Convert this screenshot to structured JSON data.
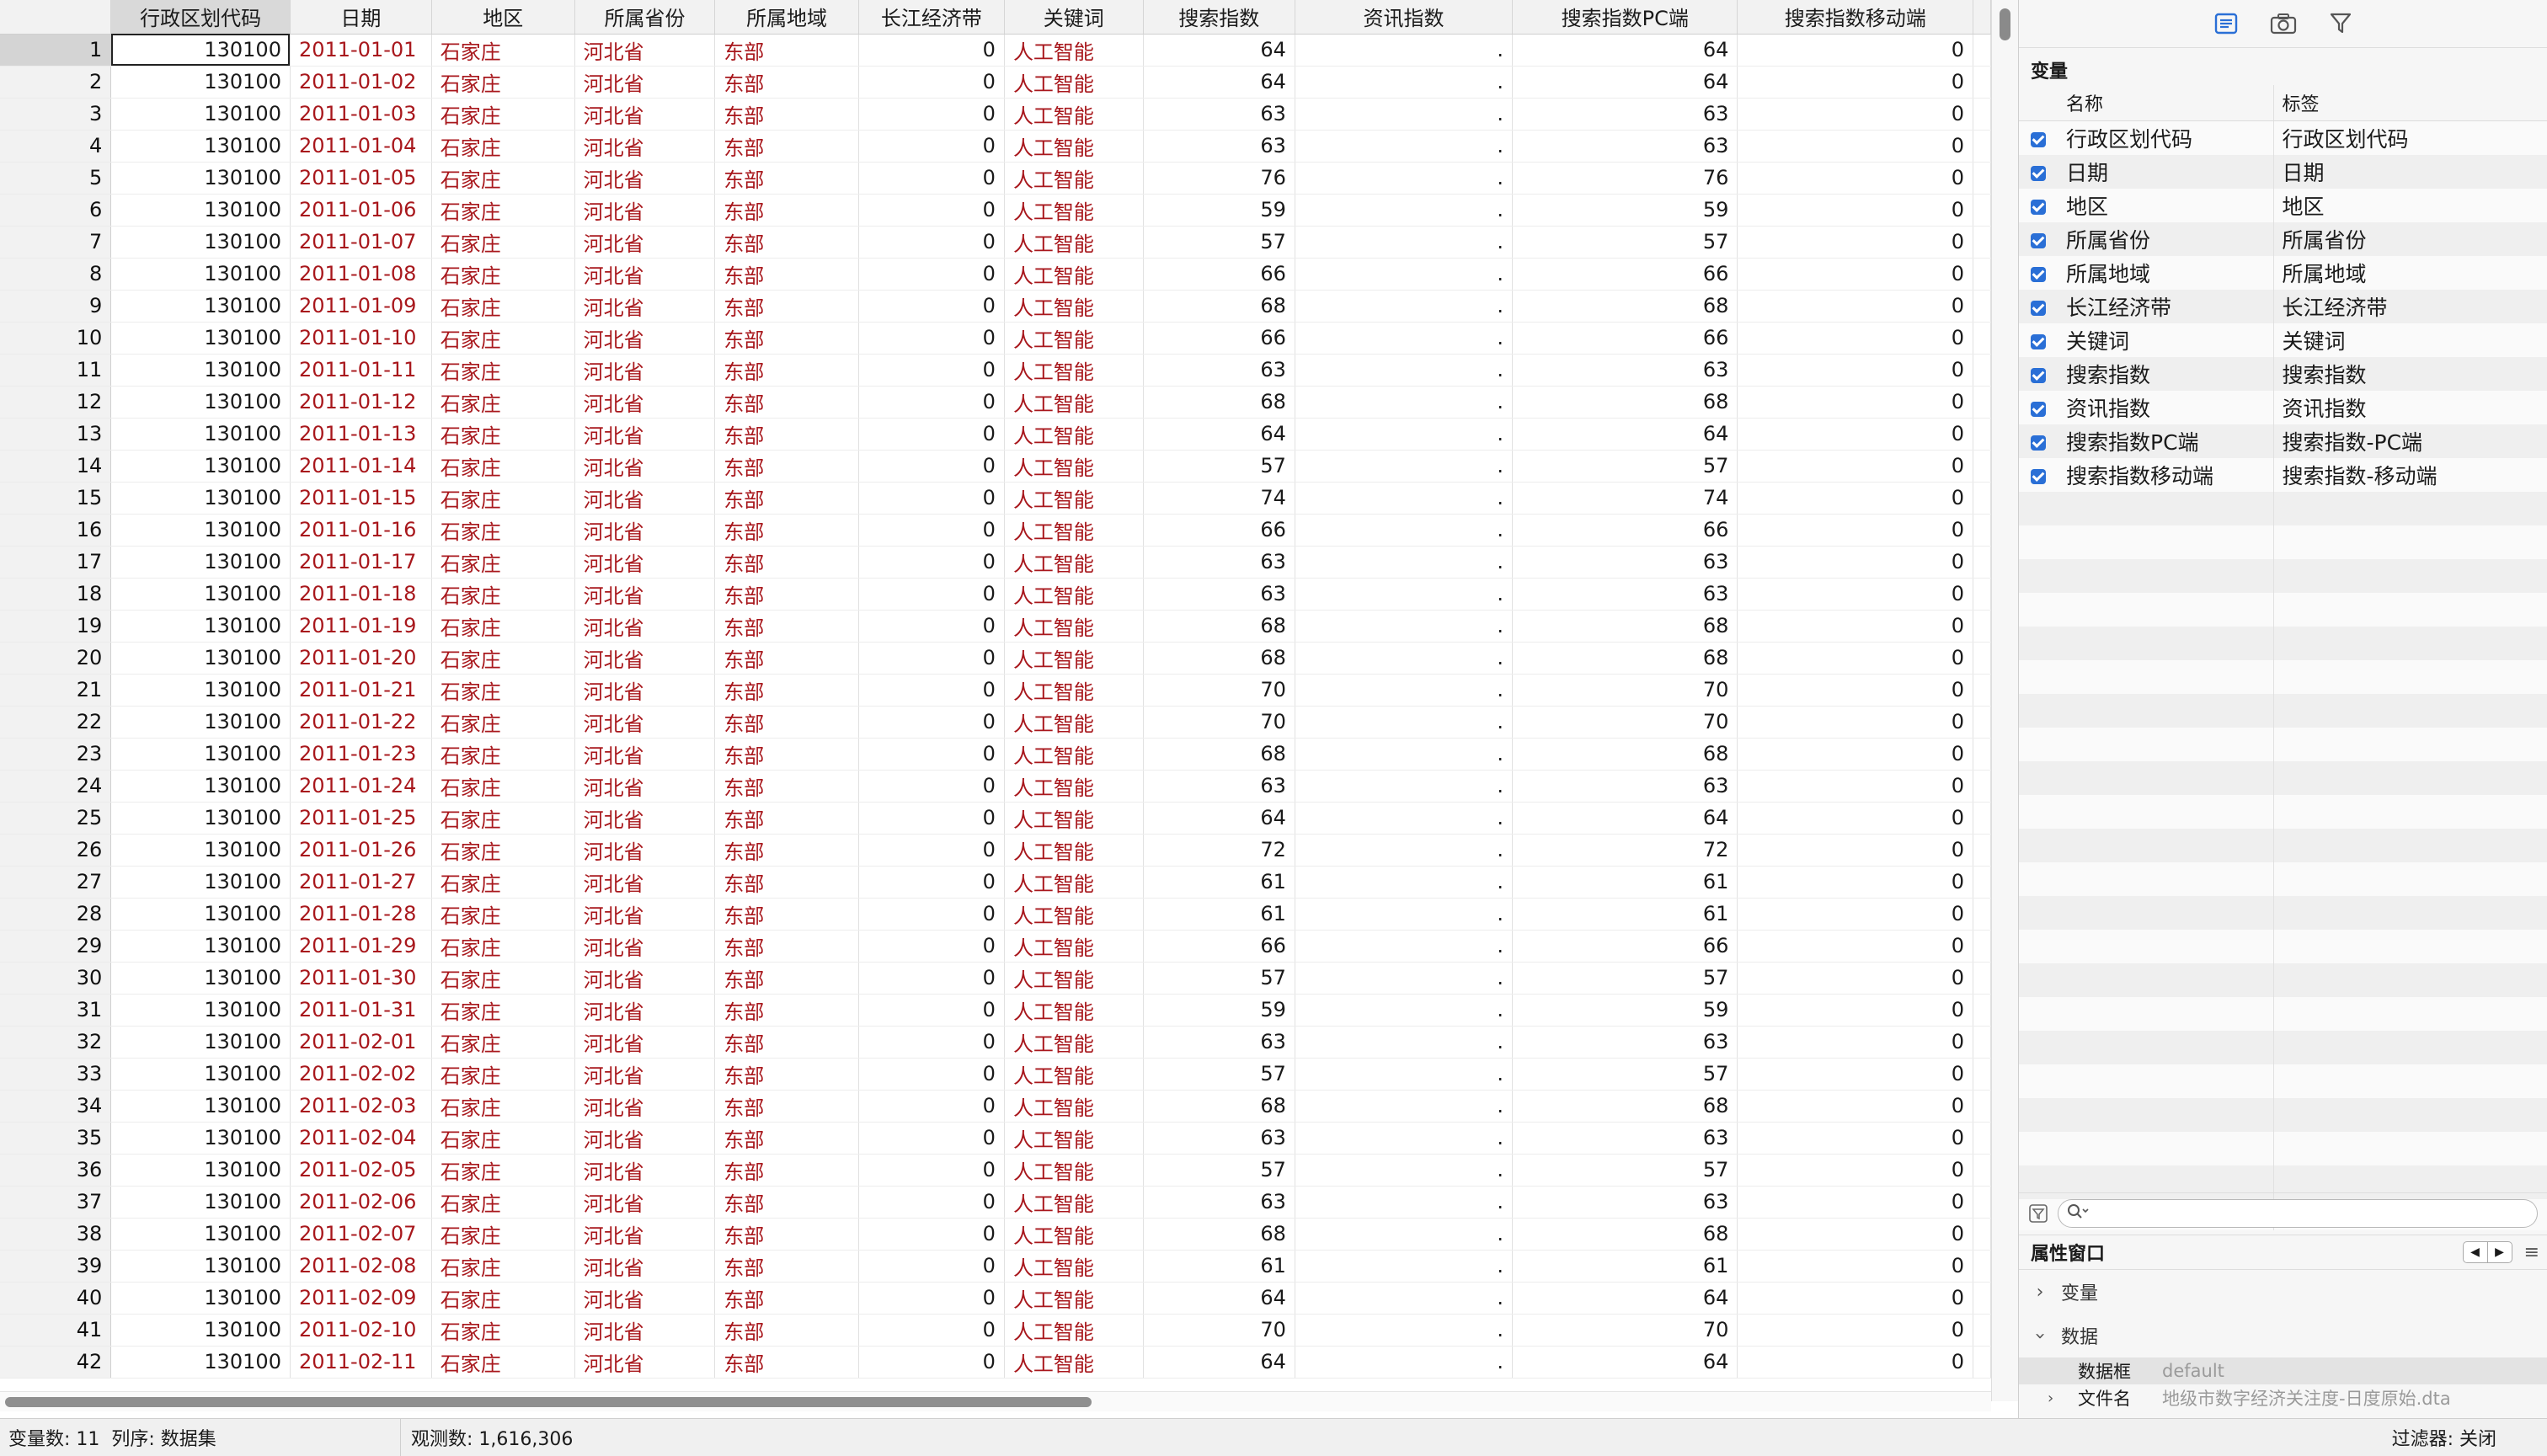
{
  "columns": [
    "行政区划代码",
    "日期",
    "地区",
    "所属省份",
    "所属地域",
    "长江经济带",
    "关键词",
    "搜索指数",
    "资讯指数",
    "搜索指数PC端",
    "搜索指数移动端"
  ],
  "column_types": [
    "num",
    "str",
    "str",
    "str",
    "str",
    "num",
    "str",
    "num",
    "dot",
    "num",
    "num"
  ],
  "sorted_column_index": 0,
  "rows": [
    [
      "130100",
      "2011-01-01",
      "石家庄",
      "河北省",
      "东部",
      "0",
      "人工智能",
      "64",
      ".",
      "64",
      "0"
    ],
    [
      "130100",
      "2011-01-02",
      "石家庄",
      "河北省",
      "东部",
      "0",
      "人工智能",
      "64",
      ".",
      "64",
      "0"
    ],
    [
      "130100",
      "2011-01-03",
      "石家庄",
      "河北省",
      "东部",
      "0",
      "人工智能",
      "63",
      ".",
      "63",
      "0"
    ],
    [
      "130100",
      "2011-01-04",
      "石家庄",
      "河北省",
      "东部",
      "0",
      "人工智能",
      "63",
      ".",
      "63",
      "0"
    ],
    [
      "130100",
      "2011-01-05",
      "石家庄",
      "河北省",
      "东部",
      "0",
      "人工智能",
      "76",
      ".",
      "76",
      "0"
    ],
    [
      "130100",
      "2011-01-06",
      "石家庄",
      "河北省",
      "东部",
      "0",
      "人工智能",
      "59",
      ".",
      "59",
      "0"
    ],
    [
      "130100",
      "2011-01-07",
      "石家庄",
      "河北省",
      "东部",
      "0",
      "人工智能",
      "57",
      ".",
      "57",
      "0"
    ],
    [
      "130100",
      "2011-01-08",
      "石家庄",
      "河北省",
      "东部",
      "0",
      "人工智能",
      "66",
      ".",
      "66",
      "0"
    ],
    [
      "130100",
      "2011-01-09",
      "石家庄",
      "河北省",
      "东部",
      "0",
      "人工智能",
      "68",
      ".",
      "68",
      "0"
    ],
    [
      "130100",
      "2011-01-10",
      "石家庄",
      "河北省",
      "东部",
      "0",
      "人工智能",
      "66",
      ".",
      "66",
      "0"
    ],
    [
      "130100",
      "2011-01-11",
      "石家庄",
      "河北省",
      "东部",
      "0",
      "人工智能",
      "63",
      ".",
      "63",
      "0"
    ],
    [
      "130100",
      "2011-01-12",
      "石家庄",
      "河北省",
      "东部",
      "0",
      "人工智能",
      "68",
      ".",
      "68",
      "0"
    ],
    [
      "130100",
      "2011-01-13",
      "石家庄",
      "河北省",
      "东部",
      "0",
      "人工智能",
      "64",
      ".",
      "64",
      "0"
    ],
    [
      "130100",
      "2011-01-14",
      "石家庄",
      "河北省",
      "东部",
      "0",
      "人工智能",
      "57",
      ".",
      "57",
      "0"
    ],
    [
      "130100",
      "2011-01-15",
      "石家庄",
      "河北省",
      "东部",
      "0",
      "人工智能",
      "74",
      ".",
      "74",
      "0"
    ],
    [
      "130100",
      "2011-01-16",
      "石家庄",
      "河北省",
      "东部",
      "0",
      "人工智能",
      "66",
      ".",
      "66",
      "0"
    ],
    [
      "130100",
      "2011-01-17",
      "石家庄",
      "河北省",
      "东部",
      "0",
      "人工智能",
      "63",
      ".",
      "63",
      "0"
    ],
    [
      "130100",
      "2011-01-18",
      "石家庄",
      "河北省",
      "东部",
      "0",
      "人工智能",
      "63",
      ".",
      "63",
      "0"
    ],
    [
      "130100",
      "2011-01-19",
      "石家庄",
      "河北省",
      "东部",
      "0",
      "人工智能",
      "68",
      ".",
      "68",
      "0"
    ],
    [
      "130100",
      "2011-01-20",
      "石家庄",
      "河北省",
      "东部",
      "0",
      "人工智能",
      "68",
      ".",
      "68",
      "0"
    ],
    [
      "130100",
      "2011-01-21",
      "石家庄",
      "河北省",
      "东部",
      "0",
      "人工智能",
      "70",
      ".",
      "70",
      "0"
    ],
    [
      "130100",
      "2011-01-22",
      "石家庄",
      "河北省",
      "东部",
      "0",
      "人工智能",
      "70",
      ".",
      "70",
      "0"
    ],
    [
      "130100",
      "2011-01-23",
      "石家庄",
      "河北省",
      "东部",
      "0",
      "人工智能",
      "68",
      ".",
      "68",
      "0"
    ],
    [
      "130100",
      "2011-01-24",
      "石家庄",
      "河北省",
      "东部",
      "0",
      "人工智能",
      "63",
      ".",
      "63",
      "0"
    ],
    [
      "130100",
      "2011-01-25",
      "石家庄",
      "河北省",
      "东部",
      "0",
      "人工智能",
      "64",
      ".",
      "64",
      "0"
    ],
    [
      "130100",
      "2011-01-26",
      "石家庄",
      "河北省",
      "东部",
      "0",
      "人工智能",
      "72",
      ".",
      "72",
      "0"
    ],
    [
      "130100",
      "2011-01-27",
      "石家庄",
      "河北省",
      "东部",
      "0",
      "人工智能",
      "61",
      ".",
      "61",
      "0"
    ],
    [
      "130100",
      "2011-01-28",
      "石家庄",
      "河北省",
      "东部",
      "0",
      "人工智能",
      "61",
      ".",
      "61",
      "0"
    ],
    [
      "130100",
      "2011-01-29",
      "石家庄",
      "河北省",
      "东部",
      "0",
      "人工智能",
      "66",
      ".",
      "66",
      "0"
    ],
    [
      "130100",
      "2011-01-30",
      "石家庄",
      "河北省",
      "东部",
      "0",
      "人工智能",
      "57",
      ".",
      "57",
      "0"
    ],
    [
      "130100",
      "2011-01-31",
      "石家庄",
      "河北省",
      "东部",
      "0",
      "人工智能",
      "59",
      ".",
      "59",
      "0"
    ],
    [
      "130100",
      "2011-02-01",
      "石家庄",
      "河北省",
      "东部",
      "0",
      "人工智能",
      "63",
      ".",
      "63",
      "0"
    ],
    [
      "130100",
      "2011-02-02",
      "石家庄",
      "河北省",
      "东部",
      "0",
      "人工智能",
      "57",
      ".",
      "57",
      "0"
    ],
    [
      "130100",
      "2011-02-03",
      "石家庄",
      "河北省",
      "东部",
      "0",
      "人工智能",
      "68",
      ".",
      "68",
      "0"
    ],
    [
      "130100",
      "2011-02-04",
      "石家庄",
      "河北省",
      "东部",
      "0",
      "人工智能",
      "63",
      ".",
      "63",
      "0"
    ],
    [
      "130100",
      "2011-02-05",
      "石家庄",
      "河北省",
      "东部",
      "0",
      "人工智能",
      "57",
      ".",
      "57",
      "0"
    ],
    [
      "130100",
      "2011-02-06",
      "石家庄",
      "河北省",
      "东部",
      "0",
      "人工智能",
      "63",
      ".",
      "63",
      "0"
    ],
    [
      "130100",
      "2011-02-07",
      "石家庄",
      "河北省",
      "东部",
      "0",
      "人工智能",
      "68",
      ".",
      "68",
      "0"
    ],
    [
      "130100",
      "2011-02-08",
      "石家庄",
      "河北省",
      "东部",
      "0",
      "人工智能",
      "61",
      ".",
      "61",
      "0"
    ],
    [
      "130100",
      "2011-02-09",
      "石家庄",
      "河北省",
      "东部",
      "0",
      "人工智能",
      "64",
      ".",
      "64",
      "0"
    ],
    [
      "130100",
      "2011-02-10",
      "石家庄",
      "河北省",
      "东部",
      "0",
      "人工智能",
      "70",
      ".",
      "70",
      "0"
    ],
    [
      "130100",
      "2011-02-11",
      "石家庄",
      "河北省",
      "东部",
      "0",
      "人工智能",
      "64",
      ".",
      "64",
      "0"
    ]
  ],
  "panel": {
    "toolbar_icons": [
      "variables-list-icon",
      "snapshot-camera-icon",
      "filter-funnel-icon"
    ],
    "variables_title": "变量",
    "col_name": "名称",
    "col_label": "标签",
    "variables": [
      {
        "name": "行政区划代码",
        "label": "行政区划代码",
        "checked": true
      },
      {
        "name": "日期",
        "label": "日期",
        "checked": true
      },
      {
        "name": "地区",
        "label": "地区",
        "checked": true
      },
      {
        "name": "所属省份",
        "label": "所属省份",
        "checked": true
      },
      {
        "name": "所属地域",
        "label": "所属地域",
        "checked": true
      },
      {
        "name": "长江经济带",
        "label": "长江经济带",
        "checked": true
      },
      {
        "name": "关键词",
        "label": "关键词",
        "checked": true
      },
      {
        "name": "搜索指数",
        "label": "搜索指数",
        "checked": true
      },
      {
        "name": "资讯指数",
        "label": "资讯指数",
        "checked": true
      },
      {
        "name": "搜索指数PC端",
        "label": "搜索指数-PC端",
        "checked": true
      },
      {
        "name": "搜索指数移动端",
        "label": "搜索指数-移动端",
        "checked": true
      }
    ],
    "search_placeholder": "",
    "properties_title": "属性窗口",
    "tree_variables": "变量",
    "tree_data": "数据",
    "prop_frame_key": "数据框",
    "prop_frame_value": "default",
    "prop_filename_key": "文件名",
    "prop_filename_value": "地级市数字经济关注度-日度原始.dta"
  },
  "status": {
    "var_count": "变量数: 11",
    "order": "列序: 数据集",
    "obs_count": "观测数: 1,616,306",
    "filter": "过滤器: 关闭"
  },
  "colors": {
    "string_text": "#a8171c",
    "checkbox": "#2a6fd6"
  }
}
